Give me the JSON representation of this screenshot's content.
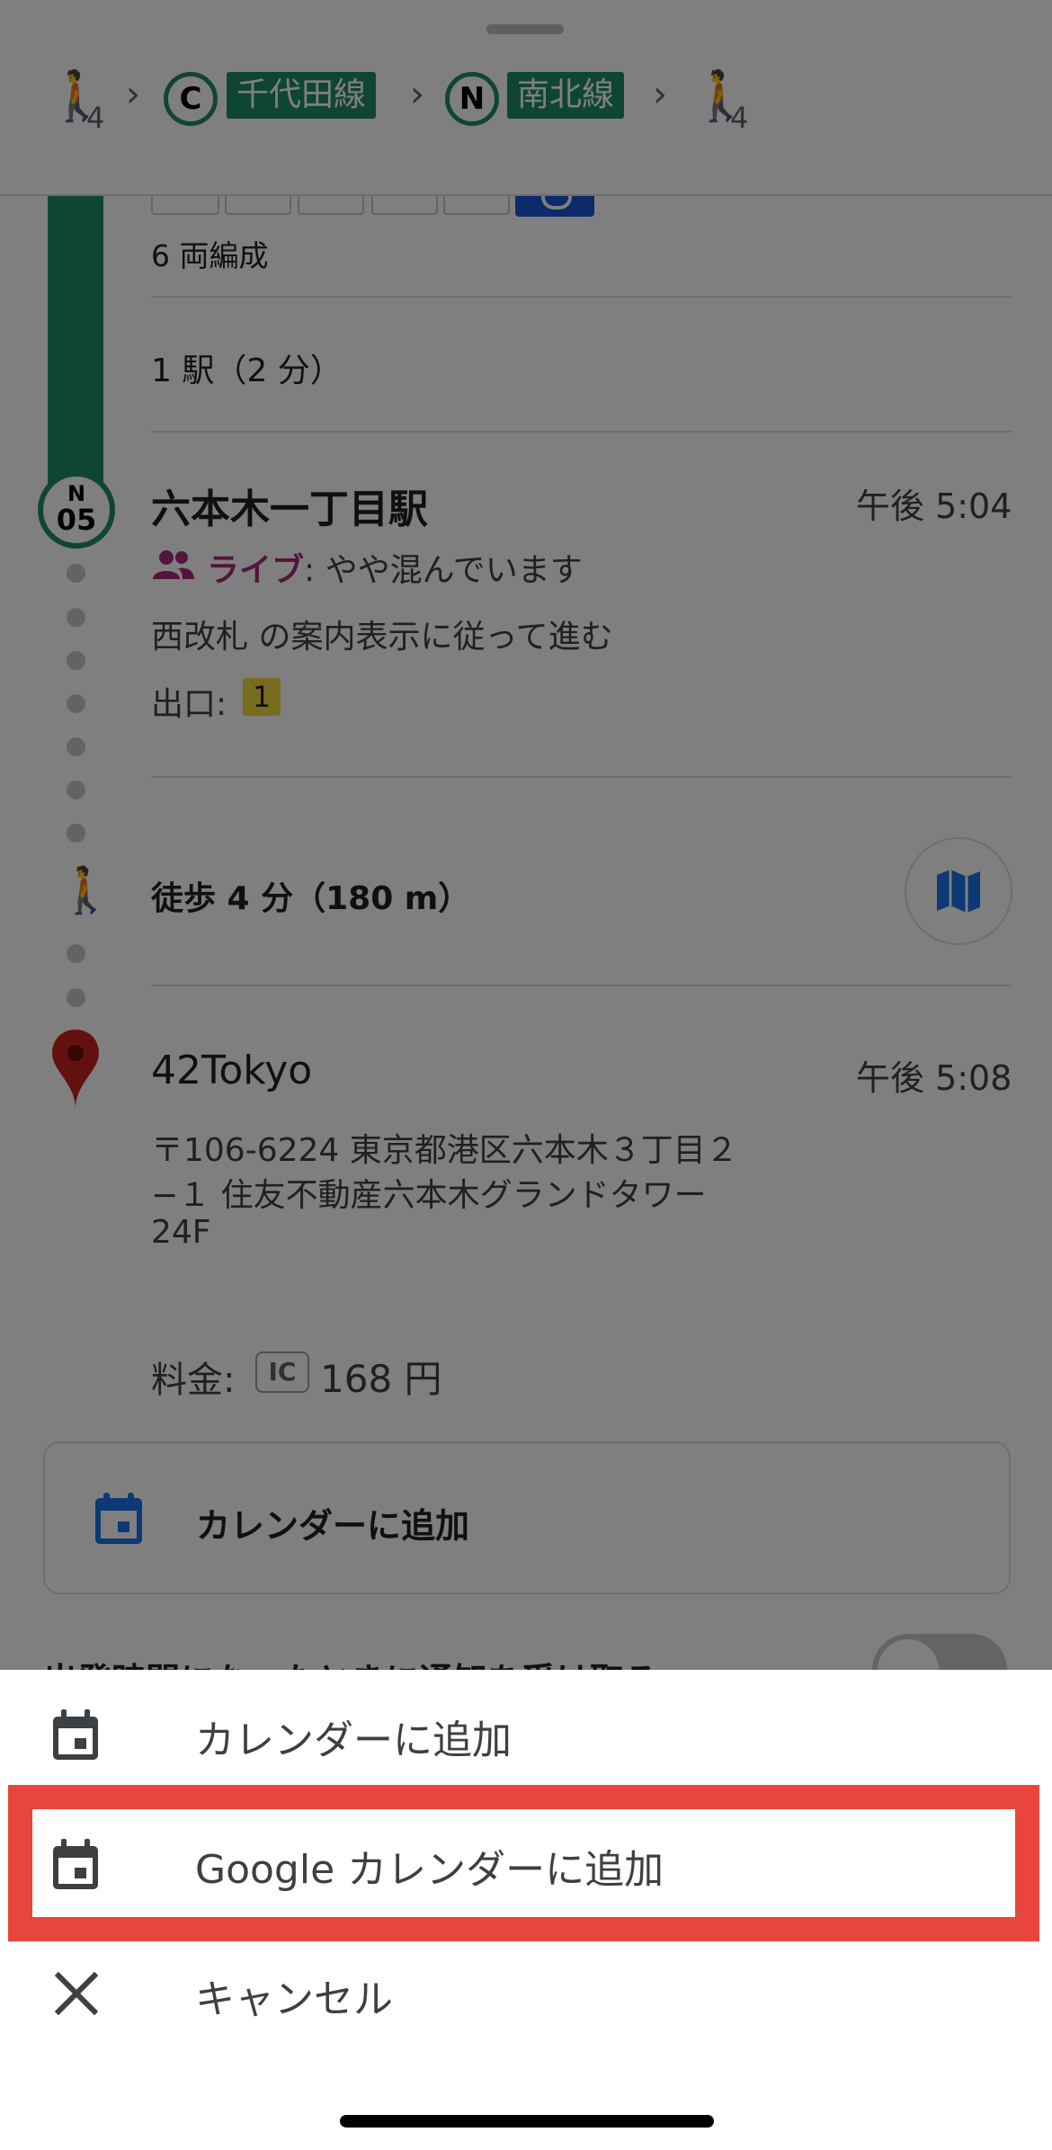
{
  "route_summary": {
    "walk_start_minutes": "4",
    "line1": {
      "badge": "C",
      "name": "千代田線",
      "color": "#1f8a6b"
    },
    "line2": {
      "badge": "N",
      "name": "南北線",
      "color": "#1f8a6b"
    },
    "walk_end_minutes": "4"
  },
  "train": {
    "cars_label": "6 両編成",
    "stops_label": "1 駅（2 分）"
  },
  "arrival_station": {
    "badge_line": "N",
    "badge_number": "05",
    "name": "六本木一丁目駅",
    "time": "午後 5:04",
    "live_label": "ライブ",
    "crowd_status": ": やや混んでいます",
    "guidance": "西改札 の案内表示に従って進む",
    "exit_label": "出口:",
    "exit_number": "1"
  },
  "walk_leg": {
    "label": "徒歩 4 分（180 m）"
  },
  "destination": {
    "name": "42Tokyo",
    "time": "午後 5:08",
    "address_line1": "〒106-6224 東京都港区六本木３丁目２",
    "address_line2": "−１ 住友不動産六本木グランドタワー",
    "address_line3": "24F"
  },
  "fare": {
    "label": "料金:",
    "ic_badge": "IC",
    "amount": "168 円"
  },
  "calendar_card": {
    "label": "カレンダーに追加"
  },
  "notify_row": {
    "label": "出発時間になったときに通知を受け取る"
  },
  "action_sheet": {
    "items": [
      {
        "label": "カレンダーに追加",
        "icon": "calendar-icon"
      },
      {
        "label": "Google カレンダーに追加",
        "icon": "calendar-icon",
        "highlighted": true
      },
      {
        "label": "キャンセル",
        "icon": "close-icon"
      }
    ]
  },
  "colors": {
    "line_green": "#1f8a6b",
    "live_magenta": "#a52a7c",
    "highlight_red": "#e8453c",
    "calendar_blue": "#1a73e8",
    "pin_red": "#c5221f"
  }
}
